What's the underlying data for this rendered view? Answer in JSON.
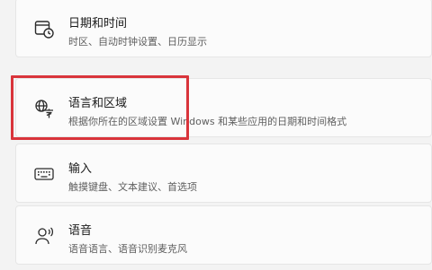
{
  "settings": {
    "items": [
      {
        "title": "日期和时间",
        "subtitle": "时区、自动时钟设置、日历显示",
        "icon": "calendar-clock-icon"
      },
      {
        "title": "语言和区域",
        "subtitle": "根据你所在的区域设置 Windows 和某些应用的日期和时间格式",
        "icon": "language-icon"
      },
      {
        "title": "输入",
        "subtitle": "触摸键盘、文本建议、首选项",
        "icon": "keyboard-icon"
      },
      {
        "title": "语音",
        "subtitle": "语音语言、语音识别麦克风",
        "icon": "speech-icon"
      }
    ]
  },
  "colors": {
    "highlight": "#d9343b",
    "card_bg": "#fbfbfb",
    "page_bg": "#f3f3f3"
  }
}
